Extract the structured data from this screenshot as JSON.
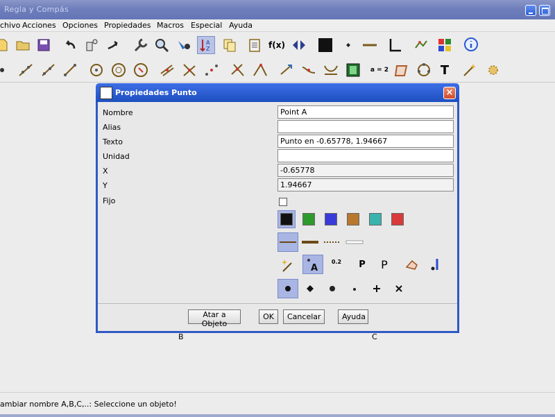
{
  "window": {
    "title": "Regla y Compás"
  },
  "menu": [
    "chivo",
    "Acciones",
    "Opciones",
    "Propiedades",
    "Macros",
    "Especial",
    "Ayuda"
  ],
  "toolbar2_text": {
    "equals": "a = 2",
    "text_tool": "T"
  },
  "toolbar1_text": {
    "function": "f(x)"
  },
  "canvas": {
    "labels": [
      "B",
      "C"
    ]
  },
  "status": "ambiar nombre A,B,C,..: Seleccione un objeto!",
  "dialog": {
    "title": "Propiedades Punto",
    "close_glyph": "×",
    "labels": {
      "name": "Nombre",
      "alias": "Alias",
      "text": "Texto",
      "unit": "Unidad",
      "x": "X",
      "y": "Y",
      "fixed": "Fijo"
    },
    "values": {
      "name": "Point A",
      "alias": "",
      "text": "Punto en -0.65778, 1.94667",
      "unit": "",
      "x": "-0.65778",
      "y": "1.94667"
    },
    "fixed_checked": false,
    "colors": [
      "#111111",
      "#2e9a2e",
      "#3a3ad8",
      "#b8782e",
      "#39b3ad",
      "#d83a3a"
    ],
    "selected_color": 0,
    "option_text": {
      "decimals": "0.2",
      "bold_p": "P",
      "plain_p": "P"
    },
    "buttons": {
      "attach": "Atar a Objeto",
      "ok": "OK",
      "cancel": "Cancelar",
      "help": "Ayuda"
    }
  }
}
